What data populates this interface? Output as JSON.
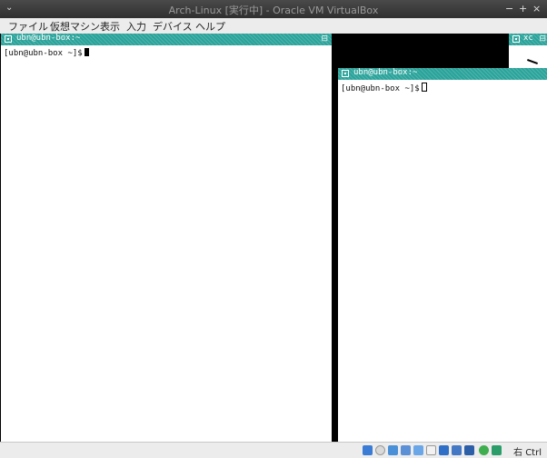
{
  "window": {
    "title": "Arch-Linux [実行中] - Oracle VM VirtualBox",
    "menu_arrow": "⌄",
    "minimize": "−",
    "maximize": "+",
    "close": "×"
  },
  "menubar": {
    "items": [
      "ファイル",
      "仮想マシン",
      "表示",
      "入力",
      "デバイス",
      "ヘルプ"
    ]
  },
  "terminals": {
    "left": {
      "title": "ubn@ubn-box:~",
      "prompt": "[ubn@ubn-box ~]$",
      "maximize_glyph": "⊟"
    },
    "right": {
      "title": "ubn@ubn-box:~",
      "prompt": "[ubn@ubn-box ~]$"
    },
    "corner": {
      "title": "xc",
      "maximize_glyph": "⊟"
    }
  },
  "statusbar": {
    "host_key": "右 Ctrl",
    "icons": [
      "hard-disk-icon",
      "optical-drive-icon",
      "audio-icon",
      "network-icon",
      "usb-icon",
      "shared-folder-icon",
      "display-icon",
      "recording-icon",
      "cpu-icon",
      "mouse-integration-icon",
      "keyboard-icon"
    ]
  },
  "colors": {
    "terminal_bar": "#2aa39a",
    "chrome": "#ececec",
    "titlebar": "#3c3c3c"
  }
}
